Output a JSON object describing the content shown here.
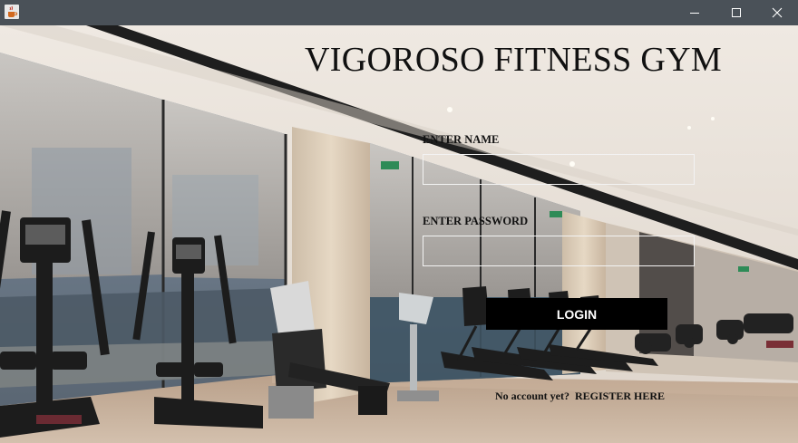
{
  "window": {
    "minimize_glyph": "─",
    "maximize_glyph": "☐",
    "close_glyph": "✕",
    "titlebar_color": "#4a5158"
  },
  "page": {
    "title": "VIGOROSO FITNESS GYM"
  },
  "form": {
    "name_label": "ENTER NAME",
    "name_value": "",
    "password_label": "ENTER PASSWORD",
    "password_value": "",
    "login_label": "LOGIN",
    "no_account_text": "No account yet?",
    "register_label": "REGISTER HERE"
  },
  "colors": {
    "button_bg": "#000000",
    "button_text": "#ffffff",
    "field_border": "#f3f3f3"
  },
  "icons": {
    "app": "java-cup-icon",
    "exit_sign": "exit-sign-icon"
  }
}
